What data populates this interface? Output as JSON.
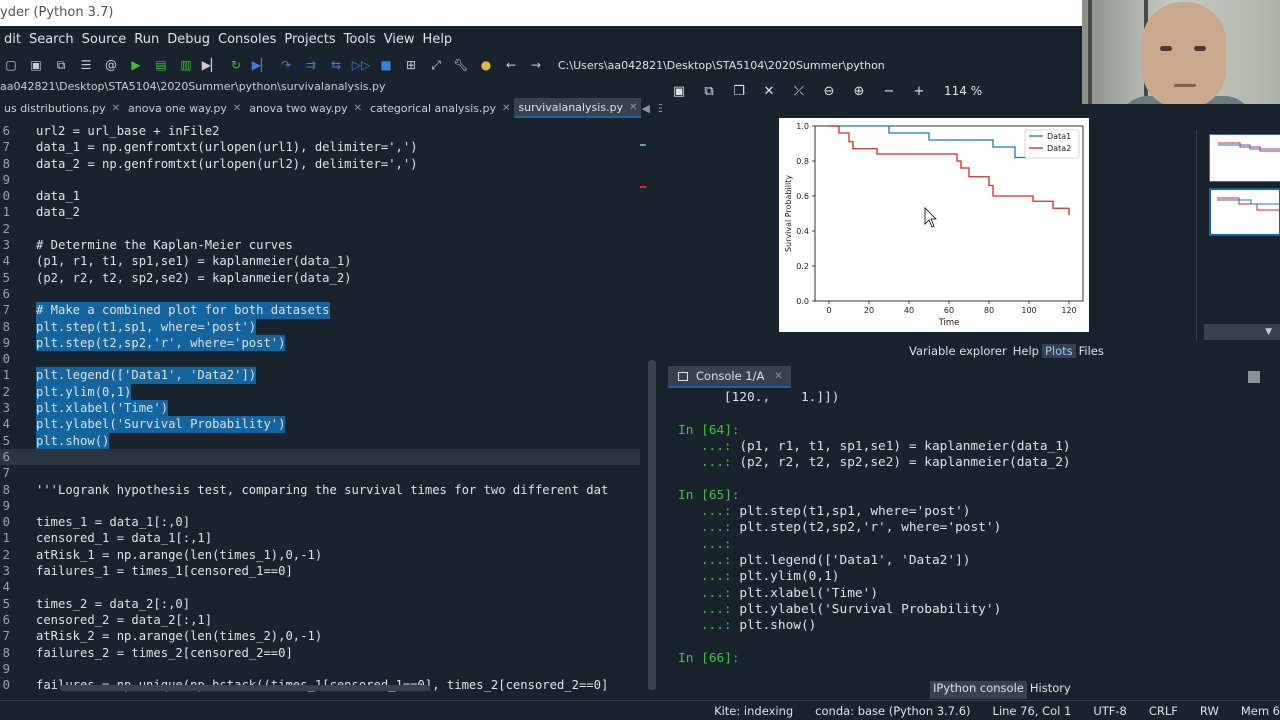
{
  "window": {
    "title": "yder (Python 3.7)"
  },
  "menu": [
    "dit",
    "Search",
    "Source",
    "Run",
    "Debug",
    "Consoles",
    "Projects",
    "Tools",
    "View",
    "Help"
  ],
  "toolbar": {
    "path": "C:\\Users\\aa042821\\Desktop\\STA5104\\2020Summer\\python"
  },
  "editor": {
    "filepath": "aa042821\\Desktop\\STA5104\\2020Summer\\python\\survivalanalysis.py",
    "tabs": [
      {
        "label": "us distributions.py",
        "active": false
      },
      {
        "label": "anova one way.py",
        "active": false
      },
      {
        "label": "anova two way.py",
        "active": false
      },
      {
        "label": "categorical analysis.py",
        "active": false
      },
      {
        "label": "survivalanalysis.py",
        "active": true
      }
    ],
    "lines": [
      {
        "num": "6",
        "text": "url2 = url_base + inFile2",
        "sel": false
      },
      {
        "num": "7",
        "text": "data_1 = np.genfromtxt(urlopen(url1), delimiter=',')",
        "sel": false
      },
      {
        "num": "8",
        "text": "data_2 = np.genfromtxt(urlopen(url2), delimiter=',')",
        "sel": false
      },
      {
        "num": "9",
        "text": "",
        "sel": false
      },
      {
        "num": "0",
        "text": "data_1",
        "sel": false
      },
      {
        "num": "1",
        "text": "data_2",
        "sel": false
      },
      {
        "num": "2",
        "text": "",
        "sel": false
      },
      {
        "num": "3",
        "text": "# Determine the Kaplan-Meier curves",
        "sel": false,
        "comment": true
      },
      {
        "num": "4",
        "text": "(p1, r1, t1, sp1,se1) = kaplanmeier(data_1)",
        "sel": false
      },
      {
        "num": "5",
        "text": "(p2, r2, t2, sp2,se2) = kaplanmeier(data_2)",
        "sel": false
      },
      {
        "num": "6",
        "text": "",
        "sel": false
      },
      {
        "num": "7",
        "text": "# Make a combined plot for both datasets",
        "sel": true
      },
      {
        "num": "8",
        "text": "plt.step(t1,sp1, where='post')",
        "sel": true
      },
      {
        "num": "9",
        "text": "plt.step(t2,sp2,'r', where='post')",
        "sel": true
      },
      {
        "num": "0",
        "text": "",
        "sel": true
      },
      {
        "num": "1",
        "text": "plt.legend(['Data1', 'Data2'])",
        "sel": true
      },
      {
        "num": "2",
        "text": "plt.ylim(0,1)",
        "sel": true
      },
      {
        "num": "3",
        "text": "plt.xlabel('Time')",
        "sel": true
      },
      {
        "num": "4",
        "text": "plt.ylabel('Survival Probability')",
        "sel": true
      },
      {
        "num": "5",
        "text": "plt.show()",
        "sel": true
      },
      {
        "num": "6",
        "text": "",
        "sel": false,
        "current": true
      },
      {
        "num": "7",
        "text": "",
        "sel": false
      },
      {
        "num": "8",
        "text": "'''Logrank hypothesis test, comparing the survival times for two different dat",
        "sel": false,
        "comment": true
      },
      {
        "num": "9",
        "text": "",
        "sel": false
      },
      {
        "num": "0",
        "text": "times_1 = data_1[:,0]",
        "sel": false
      },
      {
        "num": "1",
        "text": "censored_1 = data_1[:,1]",
        "sel": false
      },
      {
        "num": "2",
        "text": "atRisk_1 = np.arange(len(times_1),0,-1)",
        "sel": false
      },
      {
        "num": "3",
        "text": "failures_1 = times_1[censored_1==0]",
        "sel": false
      },
      {
        "num": "4",
        "text": "",
        "sel": false
      },
      {
        "num": "5",
        "text": "times_2 = data_2[:,0]",
        "sel": false
      },
      {
        "num": "6",
        "text": "censored_2 = data_2[:,1]",
        "sel": false
      },
      {
        "num": "7",
        "text": "atRisk_2 = np.arange(len(times_2),0,-1)",
        "sel": false
      },
      {
        "num": "8",
        "text": "failures_2 = times_2[censored_2==0]",
        "sel": false
      },
      {
        "num": "9",
        "text": "",
        "sel": false
      },
      {
        "num": "0",
        "text": "failures = np.unique(np.hstack((times_1[censored_1==0], times_2[censored_2==0]",
        "sel": false
      }
    ]
  },
  "plots": {
    "zoom": "114 %",
    "pane_tabs": [
      "Variable explorer",
      "Help",
      "Plots",
      "Files"
    ],
    "active_pane_tab": "Plots"
  },
  "chart_data": {
    "type": "line",
    "step": true,
    "xlabel": "Time",
    "ylabel": "Survival Probability",
    "xlim": [
      -7,
      127
    ],
    "ylim": [
      0,
      1
    ],
    "xticks": [
      "0",
      "20",
      "40",
      "60",
      "80",
      "100",
      "120"
    ],
    "yticks": [
      "0.0",
      "0.2",
      "0.4",
      "0.6",
      "0.8",
      "1.0"
    ],
    "legend": "top-right",
    "series": [
      {
        "name": "Data1",
        "color": "#1f77b4",
        "x": [
          0,
          30,
          50,
          82,
          93,
          120
        ],
        "y": [
          1.0,
          0.96,
          0.92,
          0.88,
          0.82,
          0.82
        ]
      },
      {
        "name": "Data2",
        "color": "#d62728",
        "x": [
          0,
          5,
          10,
          12,
          24,
          64,
          66,
          70,
          80,
          82,
          102,
          112,
          120
        ],
        "y": [
          1.0,
          0.96,
          0.91,
          0.87,
          0.84,
          0.8,
          0.76,
          0.71,
          0.66,
          0.6,
          0.57,
          0.53,
          0.49
        ]
      }
    ]
  },
  "console": {
    "tab_label": "Console 1/A",
    "lines": [
      {
        "kind": "out",
        "text": "       [120.,    1.]])"
      },
      {
        "kind": "blank",
        "text": ""
      },
      {
        "kind": "prompt",
        "text": "In [64]:",
        "num": "64"
      },
      {
        "kind": "cont",
        "text": "(p1, r1, t1, sp1,se1) = kaplanmeier(data_1)"
      },
      {
        "kind": "cont",
        "text": "(p2, r2, t2, sp2,se2) = kaplanmeier(data_2)"
      },
      {
        "kind": "blank",
        "text": ""
      },
      {
        "kind": "prompt",
        "text": "In [65]:",
        "num": "65"
      },
      {
        "kind": "cont",
        "text": "plt.step(t1,sp1, where='post')"
      },
      {
        "kind": "cont",
        "text": "plt.step(t2,sp2,'r', where='post')"
      },
      {
        "kind": "cont",
        "text": ""
      },
      {
        "kind": "cont",
        "text": "plt.legend(['Data1', 'Data2'])"
      },
      {
        "kind": "cont",
        "text": "plt.ylim(0,1)"
      },
      {
        "kind": "cont",
        "text": "plt.xlabel('Time')"
      },
      {
        "kind": "cont",
        "text": "plt.ylabel('Survival Probability')"
      },
      {
        "kind": "cont",
        "text": "plt.show()"
      },
      {
        "kind": "blank",
        "text": ""
      },
      {
        "kind": "prompt",
        "text": "In [66]:",
        "num": "66"
      }
    ],
    "bottom_tabs": [
      "IPython console",
      "History"
    ],
    "active_bottom_tab": "IPython console"
  },
  "status": {
    "kite": "Kite: indexing",
    "conda": "conda: base (Python 3.7.6)",
    "position": "Line 76, Col 1",
    "encoding": "UTF-8",
    "eol": "CRLF",
    "mode": "RW",
    "mem": "Mem 6"
  }
}
